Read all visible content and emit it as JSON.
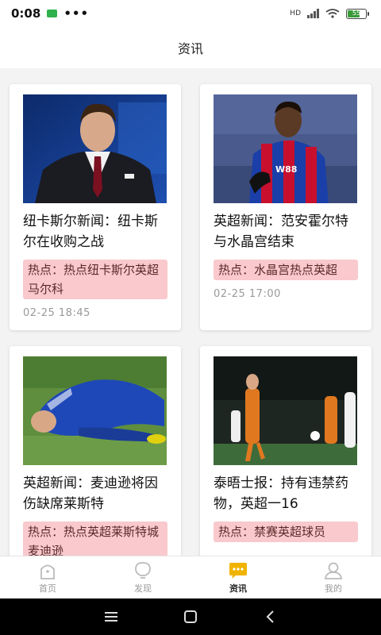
{
  "status_bar": {
    "time": "0:08",
    "dots": "•••",
    "network": "HD",
    "battery": "55"
  },
  "header": {
    "title": "资讯"
  },
  "articles": [
    {
      "title": "纽卡斯尔新闻：纽卡斯尔在收购之战",
      "hot": "热点：热点纽卡斯尔英超马尔科",
      "date": "02-25 18:45",
      "image": "man-in-suit-photo"
    },
    {
      "title": "英超新闻：范安霍尔特与水晶宫结束",
      "hot": "热点：水晶宫热点英超",
      "date": "02-25 17:00",
      "image": "crystal-palace-player-photo"
    },
    {
      "title": "英超新闻：麦迪逊将因伤缺席莱斯特",
      "hot": "热点：热点英超莱斯特城麦迪逊",
      "date": "",
      "image": "injured-player-photo"
    },
    {
      "title": "泰晤士报：持有违禁药物，英超一16",
      "hot": "热点：禁赛英超球员",
      "date": "",
      "image": "player-on-pitch-photo"
    }
  ],
  "tabs": [
    {
      "label": "首页",
      "icon": "home-icon",
      "active": false
    },
    {
      "label": "发现",
      "icon": "lightbulb-icon",
      "active": false
    },
    {
      "label": "资讯",
      "icon": "news-chat-icon",
      "active": true
    },
    {
      "label": "我的",
      "icon": "user-icon",
      "active": false
    }
  ],
  "colors": {
    "accent": "#f0b400",
    "hot_bg": "#f9c9cd",
    "page_bg": "#f3f3f3"
  }
}
